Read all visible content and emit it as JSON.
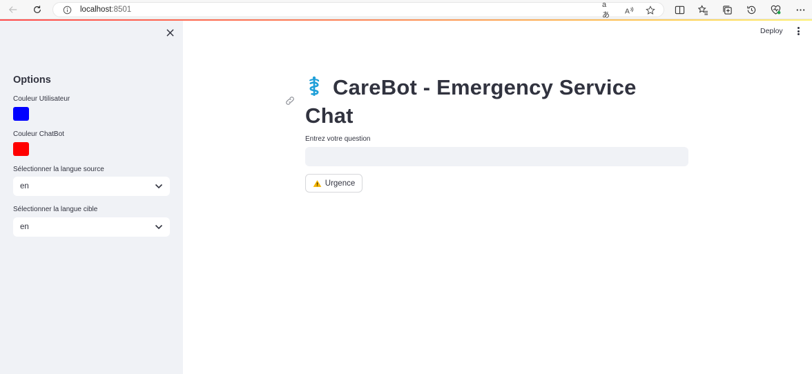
{
  "browser": {
    "url_host": "localhost",
    "url_port": ":8501",
    "translate_glyph": "aあ",
    "read_aloud_glyph": "A)"
  },
  "sidebar": {
    "title": "Options",
    "user_color_label": "Couleur Utilisateur",
    "user_color": "#0000ff",
    "bot_color_label": "Couleur ChatBot",
    "bot_color": "#ff0000",
    "source_lang_label": "Sélectionner la langue source",
    "source_lang_value": "en",
    "target_lang_label": "Sélectionner la langue cible",
    "target_lang_value": "en"
  },
  "header": {
    "deploy_label": "Deploy"
  },
  "main": {
    "title": "CareBot - Emergency Service Chat",
    "question_label": "Entrez votre question",
    "question_value": "",
    "urgent_button_label": "Urgence"
  },
  "colors": {
    "accent": "#ff4b4b",
    "sidebar_bg": "#f0f2f6",
    "text": "#31333f",
    "emoji_blue": "#1e9fd8",
    "warning_yellow": "#f4b400"
  }
}
